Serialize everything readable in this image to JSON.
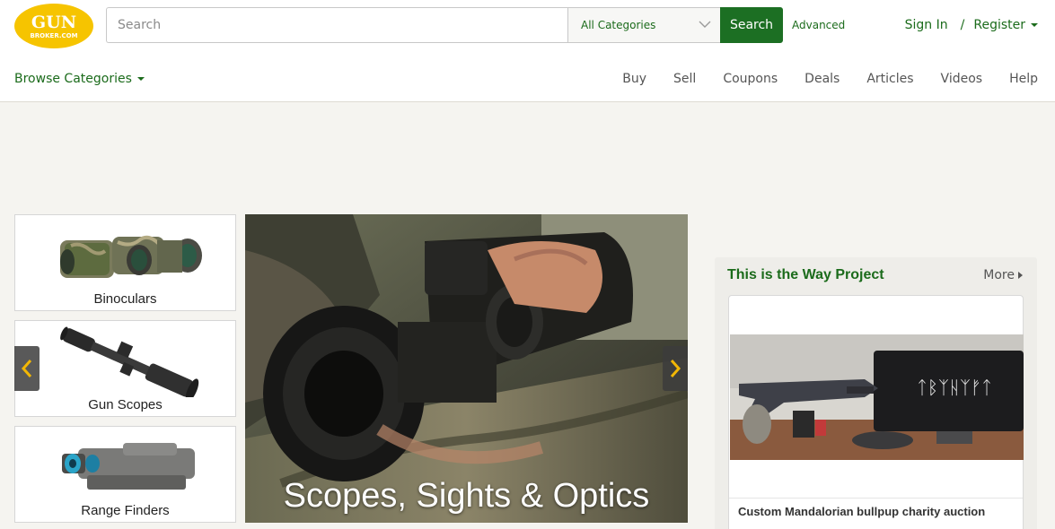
{
  "brand": {
    "logo_line1": "GUN",
    "logo_line2": "BROKER.COM",
    "logo_color": "#f6c400",
    "primary_green": "#1c6f23"
  },
  "search": {
    "placeholder": "Search",
    "category_selected": "All Categories",
    "button_label": "Search",
    "advanced_label": "Advanced"
  },
  "account": {
    "sign_in": "Sign In",
    "separator": "/",
    "register": "Register"
  },
  "nav": {
    "browse_label": "Browse Categories",
    "items": [
      "Buy",
      "Sell",
      "Coupons",
      "Deals",
      "Articles",
      "Videos",
      "Help"
    ]
  },
  "categories": [
    {
      "label": "Binoculars",
      "icon": "binoculars-icon"
    },
    {
      "label": "Gun Scopes",
      "icon": "rifle-scope-icon"
    },
    {
      "label": "Range Finders",
      "icon": "range-finder-icon"
    }
  ],
  "hero": {
    "caption": "Scopes, Sights & Optics"
  },
  "featured": {
    "title": "This is the Way Project",
    "more_label": "More",
    "card_caption": "Custom Mandalorian bullpup charity auction"
  }
}
